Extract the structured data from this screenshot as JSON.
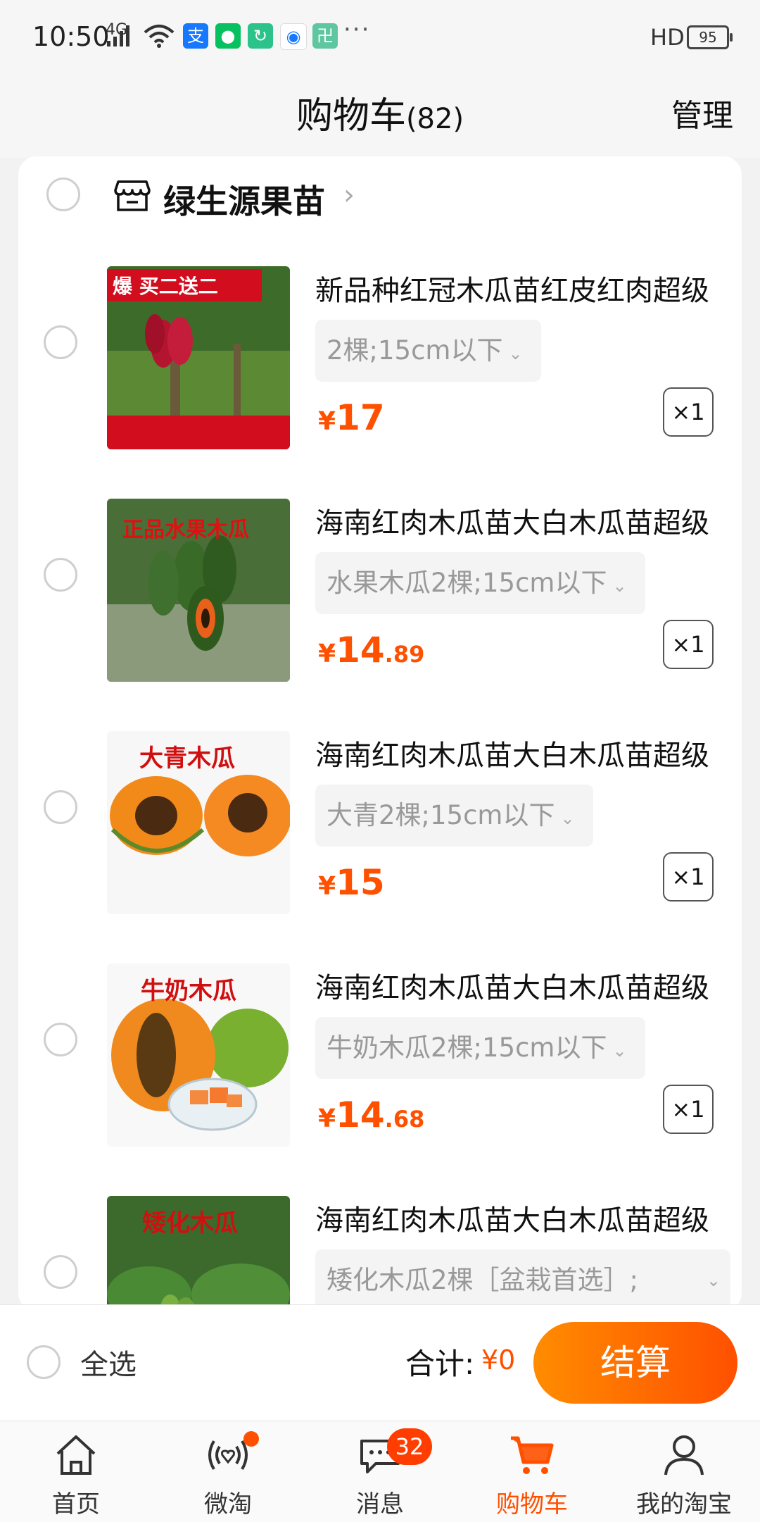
{
  "status_bar": {
    "time": "10:50",
    "network": "4G",
    "hd": "HD",
    "battery": "95",
    "more": "···"
  },
  "header": {
    "title": "购物车",
    "count": "(82)",
    "manage": "管理"
  },
  "store": {
    "name": "绿生源果苗",
    "icon": "store-icon"
  },
  "items": [
    {
      "title": "新品种红冠木瓜苗红皮红肉超级",
      "sku": "2棵;15cm以下",
      "price_int": "17",
      "price_dec": "",
      "qty": "×1",
      "image_text": "爆 买二送二"
    },
    {
      "title": "海南红肉木瓜苗大白木瓜苗超级",
      "sku": "水果木瓜2棵;15cm以下",
      "price_int": "14",
      "price_dec": ".89",
      "qty": "×1",
      "image_text": "正品水果木瓜"
    },
    {
      "title": "海南红肉木瓜苗大白木瓜苗超级",
      "sku": "大青2棵;15cm以下",
      "price_int": "15",
      "price_dec": "",
      "qty": "×1",
      "image_text": "大青木瓜"
    },
    {
      "title": "海南红肉木瓜苗大白木瓜苗超级",
      "sku": "牛奶木瓜2棵;15cm以下",
      "price_int": "14",
      "price_dec": ".68",
      "qty": "×1",
      "image_text": "牛奶木瓜"
    },
    {
      "title": "海南红肉木瓜苗大白木瓜苗超级",
      "sku": "矮化木瓜2棵［盆栽首选］;",
      "price_int": "",
      "price_dec": "",
      "qty": "",
      "image_text": "矮化木瓜"
    }
  ],
  "currency": "¥",
  "checkout": {
    "select_all": "全选",
    "total_label": "合计:",
    "total_value": "¥0",
    "pay": "结算"
  },
  "tabbar": {
    "tabs": [
      {
        "label": "首页",
        "icon": "home-icon"
      },
      {
        "label": "微淘",
        "icon": "weitao-icon"
      },
      {
        "label": "消息",
        "icon": "message-icon",
        "badge": "32"
      },
      {
        "label": "购物车",
        "icon": "cart-icon",
        "active": true
      },
      {
        "label": "我的淘宝",
        "icon": "profile-icon"
      }
    ]
  },
  "colors": {
    "accent": "#ff5000",
    "accent_light": "#ff8c00"
  }
}
